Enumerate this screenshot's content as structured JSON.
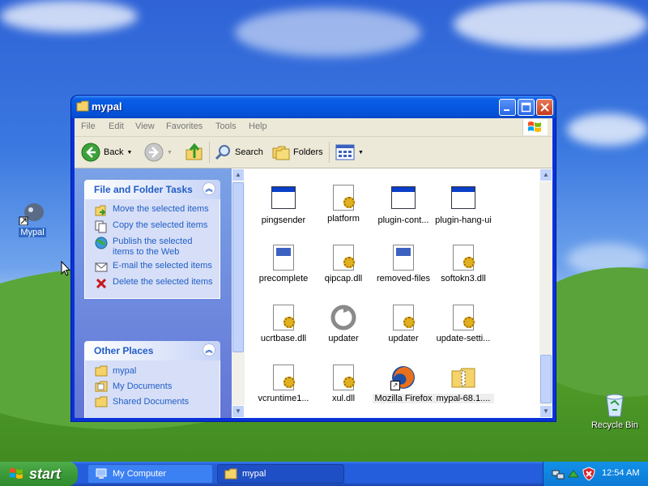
{
  "desktop": {
    "icons": [
      {
        "label": "Mypal"
      },
      {
        "label": "Recycle Bin"
      }
    ]
  },
  "window": {
    "title": "mypal",
    "menu": [
      "File",
      "Edit",
      "View",
      "Favorites",
      "Tools",
      "Help"
    ],
    "toolbar": {
      "back": "Back",
      "search": "Search",
      "folders": "Folders"
    },
    "tasks_panel": {
      "title": "File and Folder Tasks",
      "items": [
        {
          "label": "Move the selected items",
          "icon": "move-icon"
        },
        {
          "label": "Copy the selected items",
          "icon": "copy-icon"
        },
        {
          "label": "Publish the selected items to the Web",
          "icon": "publish-icon"
        },
        {
          "label": "E-mail the selected items",
          "icon": "email-icon"
        },
        {
          "label": "Delete the selected items",
          "icon": "delete-icon"
        }
      ]
    },
    "places_panel": {
      "title": "Other Places",
      "items": [
        {
          "label": "mypal"
        },
        {
          "label": "My Documents"
        },
        {
          "label": "Shared Documents"
        }
      ]
    },
    "files": [
      {
        "name": "pingsender",
        "type": "exe"
      },
      {
        "name": "platform",
        "type": "ini"
      },
      {
        "name": "plugin-cont...",
        "type": "exe"
      },
      {
        "name": "plugin-hang-ui",
        "type": "exe"
      },
      {
        "name": "precomplete",
        "type": "file"
      },
      {
        "name": "qipcap.dll",
        "type": "dll"
      },
      {
        "name": "removed-files",
        "type": "file"
      },
      {
        "name": "softokn3.dll",
        "type": "dll"
      },
      {
        "name": "ucrtbase.dll",
        "type": "dll"
      },
      {
        "name": "updater",
        "type": "updater"
      },
      {
        "name": "updater",
        "type": "ini"
      },
      {
        "name": "update-setti...",
        "type": "ini"
      },
      {
        "name": "vcruntime1...",
        "type": "dll"
      },
      {
        "name": "xul.dll",
        "type": "dll"
      },
      {
        "name": "Mozilla Firefox",
        "type": "firefox"
      },
      {
        "name": "mypal-68.1....",
        "type": "zip"
      }
    ]
  },
  "taskbar": {
    "start": "start",
    "tasks": [
      {
        "label": "My Computer"
      },
      {
        "label": "mypal"
      }
    ],
    "clock": "12:54 AM"
  }
}
